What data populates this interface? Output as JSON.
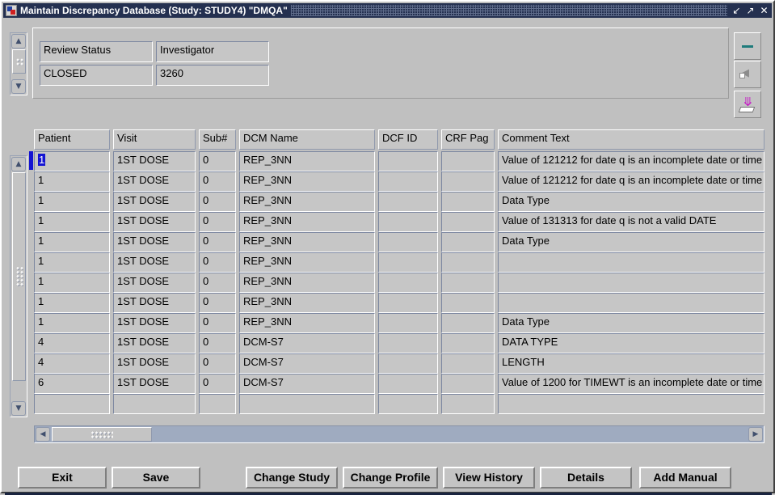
{
  "window": {
    "title": "Maintain Discrepancy Database (Study: STUDY4) \"DMQA\"",
    "icon": "application-icon",
    "controls": {
      "minimize": "↙",
      "maximize": "↗",
      "close": "✕"
    }
  },
  "header": {
    "review_status_label": "Review Status",
    "review_status_value": "CLOSED",
    "investigator_label": "Investigator",
    "investigator_value": "3260"
  },
  "toolbar": {
    "minus_title": "Minus",
    "collapse_title": "Collapse",
    "download_title": "Download"
  },
  "grid": {
    "columns": [
      "Patient",
      "Visit",
      "Sub#",
      "DCM Name",
      "DCF ID",
      "CRF Pag",
      "Comment Text"
    ],
    "rows": [
      {
        "patient": "1",
        "visit": "1ST DOSE",
        "sub": "0",
        "dcm": "REP_3NN",
        "dcfid": "",
        "crf": "",
        "comment": "Value of 121212 for date q is an incomplete date or time",
        "selected": true
      },
      {
        "patient": "1",
        "visit": "1ST DOSE",
        "sub": "0",
        "dcm": "REP_3NN",
        "dcfid": "",
        "crf": "",
        "comment": "Value of 121212 for date q is an incomplete date or time",
        "selected": false
      },
      {
        "patient": "1",
        "visit": "1ST DOSE",
        "sub": "0",
        "dcm": "REP_3NN",
        "dcfid": "",
        "crf": "",
        "comment": "Data Type",
        "selected": false
      },
      {
        "patient": "1",
        "visit": "1ST DOSE",
        "sub": "0",
        "dcm": "REP_3NN",
        "dcfid": "",
        "crf": "",
        "comment": "Value of 131313 for date q is not a valid DATE",
        "selected": false
      },
      {
        "patient": "1",
        "visit": "1ST DOSE",
        "sub": "0",
        "dcm": "REP_3NN",
        "dcfid": "",
        "crf": "",
        "comment": "Data Type",
        "selected": false
      },
      {
        "patient": "1",
        "visit": "1ST DOSE",
        "sub": "0",
        "dcm": "REP_3NN",
        "dcfid": "",
        "crf": "",
        "comment": "",
        "selected": false
      },
      {
        "patient": "1",
        "visit": "1ST DOSE",
        "sub": "0",
        "dcm": "REP_3NN",
        "dcfid": "",
        "crf": "",
        "comment": "",
        "selected": false
      },
      {
        "patient": "1",
        "visit": "1ST DOSE",
        "sub": "0",
        "dcm": "REP_3NN",
        "dcfid": "",
        "crf": "",
        "comment": "",
        "selected": false
      },
      {
        "patient": "1",
        "visit": "1ST DOSE",
        "sub": "0",
        "dcm": "REP_3NN",
        "dcfid": "",
        "crf": "",
        "comment": "Data Type",
        "selected": false
      },
      {
        "patient": "4",
        "visit": "1ST DOSE",
        "sub": "0",
        "dcm": "DCM-S7",
        "dcfid": "",
        "crf": "",
        "comment": "DATA TYPE",
        "selected": false
      },
      {
        "patient": "4",
        "visit": "1ST DOSE",
        "sub": "0",
        "dcm": "DCM-S7",
        "dcfid": "",
        "crf": "",
        "comment": "LENGTH",
        "selected": false
      },
      {
        "patient": "6",
        "visit": "1ST DOSE",
        "sub": "0",
        "dcm": "DCM-S7",
        "dcfid": "",
        "crf": "",
        "comment": "Value of 1200 for TIMEWT is an incomplete date or time",
        "selected": false
      },
      {
        "patient": "",
        "visit": "",
        "sub": "",
        "dcm": "",
        "dcfid": "",
        "crf": "",
        "comment": "",
        "selected": false
      }
    ]
  },
  "scrollbars": {
    "up_arrow": "▲",
    "down_arrow": "▼",
    "left_arrow": "◀",
    "right_arrow": "▶"
  },
  "buttons": {
    "exit": "Exit",
    "save": "Save",
    "change_study": "Change Study",
    "change_profile": "Change Profile",
    "view_history": "View History",
    "details": "Details",
    "add_manual": "Add Manual"
  },
  "colors": {
    "face": "#c0c0c0",
    "field": "#c6c6c6",
    "titlebar": "#243050",
    "selection": "#1414d2",
    "scroll_track": "#9fabc0",
    "accent_magenta": "#c415c4",
    "accent_teal": "#1e7b7b"
  }
}
